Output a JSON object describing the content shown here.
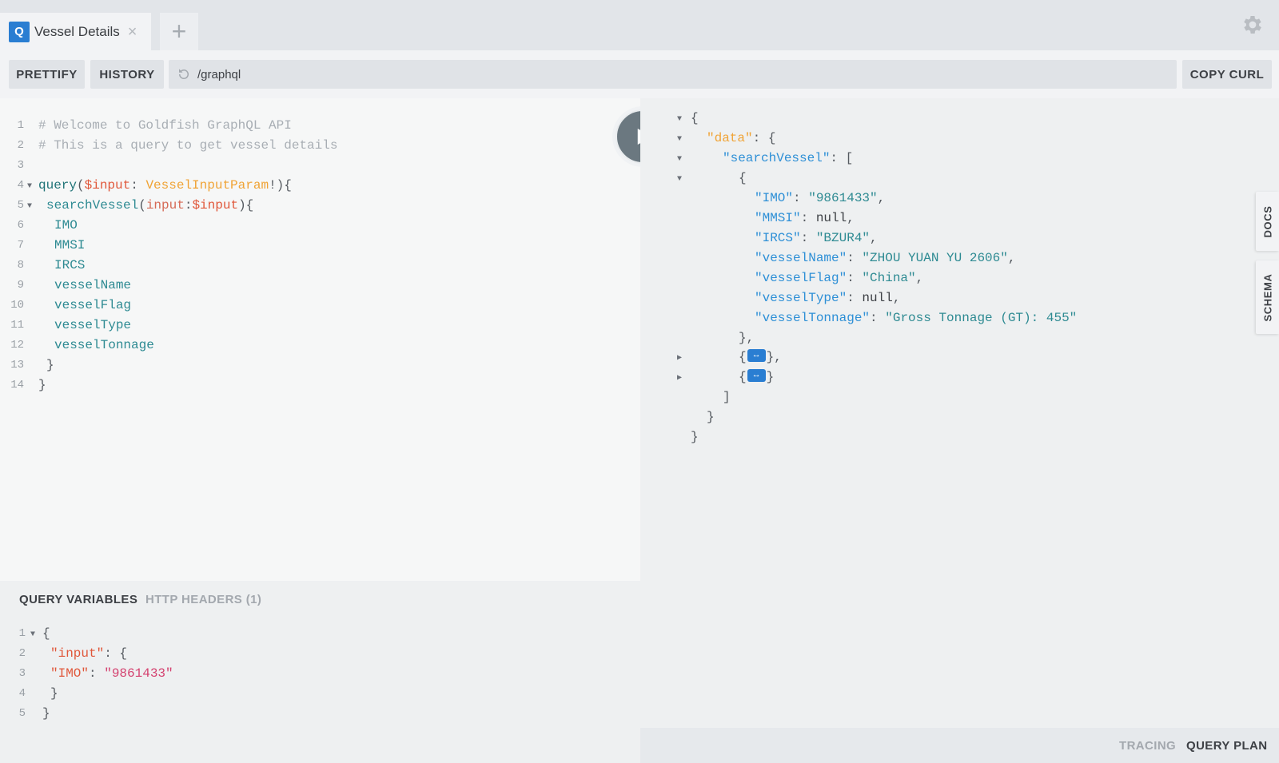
{
  "tabbar": {
    "tab_icon": "Q",
    "tab_title": "Vessel Details",
    "close_glyph": "×",
    "add_glyph": "+",
    "accent_color": "#2a7ed2"
  },
  "toolbar": {
    "prettify_label": "PRETTIFY",
    "history_label": "HISTORY",
    "endpoint": "/graphql",
    "copy_curl_label": "COPY CURL"
  },
  "editor": {
    "line_numbers": [
      "1",
      "2",
      "3",
      "4",
      "5",
      "6",
      "7",
      "8",
      "9",
      "10",
      "11",
      "12",
      "13",
      "14"
    ],
    "comment1": "# Welcome to Goldfish GraphQL API",
    "comment2": "# This is a query to get vessel details",
    "kw_query": "query",
    "var_input": "$input",
    "type_name": "VesselInputParam",
    "field_search": "searchVessel",
    "arg_input": "input",
    "fields": [
      "IMO",
      "MMSI",
      "IRCS",
      "vesselName",
      "vesselFlag",
      "vesselType",
      "vesselTonnage"
    ]
  },
  "variables": {
    "tab_query_variables": "QUERY VARIABLES",
    "tab_http_headers": "HTTP HEADERS (1)",
    "line_numbers": [
      "1",
      "2",
      "3",
      "4",
      "5"
    ],
    "key_input": "\"input\"",
    "key_imo": "\"IMO\"",
    "value_imo": "\"9861433\""
  },
  "results": {
    "key_data": "\"data\"",
    "key_search": "\"searchVessel\"",
    "rows": [
      {
        "key": "\"IMO\"",
        "value": "\"9861433\"",
        "kind": "str",
        "comma": ","
      },
      {
        "key": "\"MMSI\"",
        "value": "null",
        "kind": "null",
        "comma": ","
      },
      {
        "key": "\"IRCS\"",
        "value": "\"BZUR4\"",
        "kind": "str",
        "comma": ","
      },
      {
        "key": "\"vesselName\"",
        "value": "\"ZHOU YUAN YU 2606\"",
        "kind": "str",
        "comma": ","
      },
      {
        "key": "\"vesselFlag\"",
        "value": "\"China\"",
        "kind": "str",
        "comma": ","
      },
      {
        "key": "\"vesselType\"",
        "value": "null",
        "kind": "null",
        "comma": ","
      },
      {
        "key": "\"vesselTonnage\"",
        "value": "\"Gross Tonnage (GT): 455\"",
        "kind": "str",
        "comma": ""
      }
    ],
    "collapsed_glyph": "↔"
  },
  "side_tabs": {
    "docs": "DOCS",
    "schema": "SCHEMA"
  },
  "bottom": {
    "tracing": "TRACING",
    "query_plan": "QUERY PLAN"
  },
  "icons": {
    "settings": "gear-icon",
    "run": "play-icon",
    "reload": "reload-icon"
  }
}
